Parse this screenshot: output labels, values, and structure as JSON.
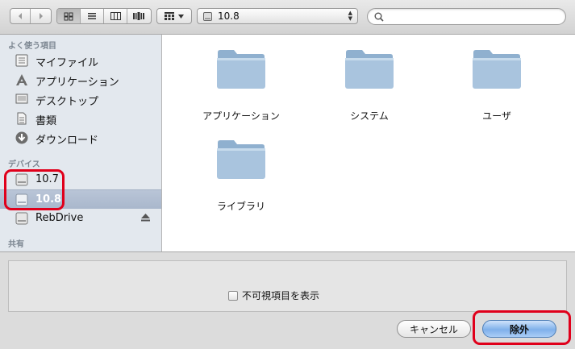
{
  "toolbar": {
    "back_icon": "chevron-left-icon",
    "forward_icon": "chevron-right-icon",
    "view_icons": [
      "icon-view-icon",
      "list-view-icon",
      "column-view-icon",
      "coverflow-view-icon"
    ],
    "arrange_icon": "arrange-grid-icon",
    "location": {
      "icon": "drive-icon",
      "value": "10.8"
    },
    "search": {
      "value": "",
      "placeholder": ""
    }
  },
  "sidebar": {
    "favorites_title": "よく使う項目",
    "favorites": [
      {
        "label": "マイファイル",
        "icon": "my-files-icon"
      },
      {
        "label": "アプリケーション",
        "icon": "applications-icon"
      },
      {
        "label": "デスクトップ",
        "icon": "desktop-icon"
      },
      {
        "label": "書類",
        "icon": "documents-icon"
      },
      {
        "label": "ダウンロード",
        "icon": "downloads-icon"
      }
    ],
    "devices_title": "デバイス",
    "devices": [
      {
        "label": "10.7",
        "icon": "drive-icon"
      },
      {
        "label": "10.8",
        "icon": "drive-icon",
        "selected": true
      },
      {
        "label": "RebDrive",
        "icon": "drive-icon",
        "eject": true
      }
    ],
    "shared_title": "共有"
  },
  "browser": {
    "items": [
      {
        "name": "アプリケーション",
        "icon": "folder-icon"
      },
      {
        "name": "システム",
        "icon": "folder-icon"
      },
      {
        "name": "ユーザ",
        "icon": "folder-icon"
      },
      {
        "name": "ライブラリ",
        "icon": "folder-icon"
      }
    ]
  },
  "options": {
    "show_invisible_label": "不可視項目を表示",
    "show_invisible_checked": false
  },
  "buttons": {
    "cancel": "キャンセル",
    "remove": "除外"
  },
  "colors": {
    "sidebar_bg": "#e3e8ee",
    "selection": "#a9b7cc",
    "default_button": "#7fb0ea",
    "annotation": "#e0001b"
  }
}
